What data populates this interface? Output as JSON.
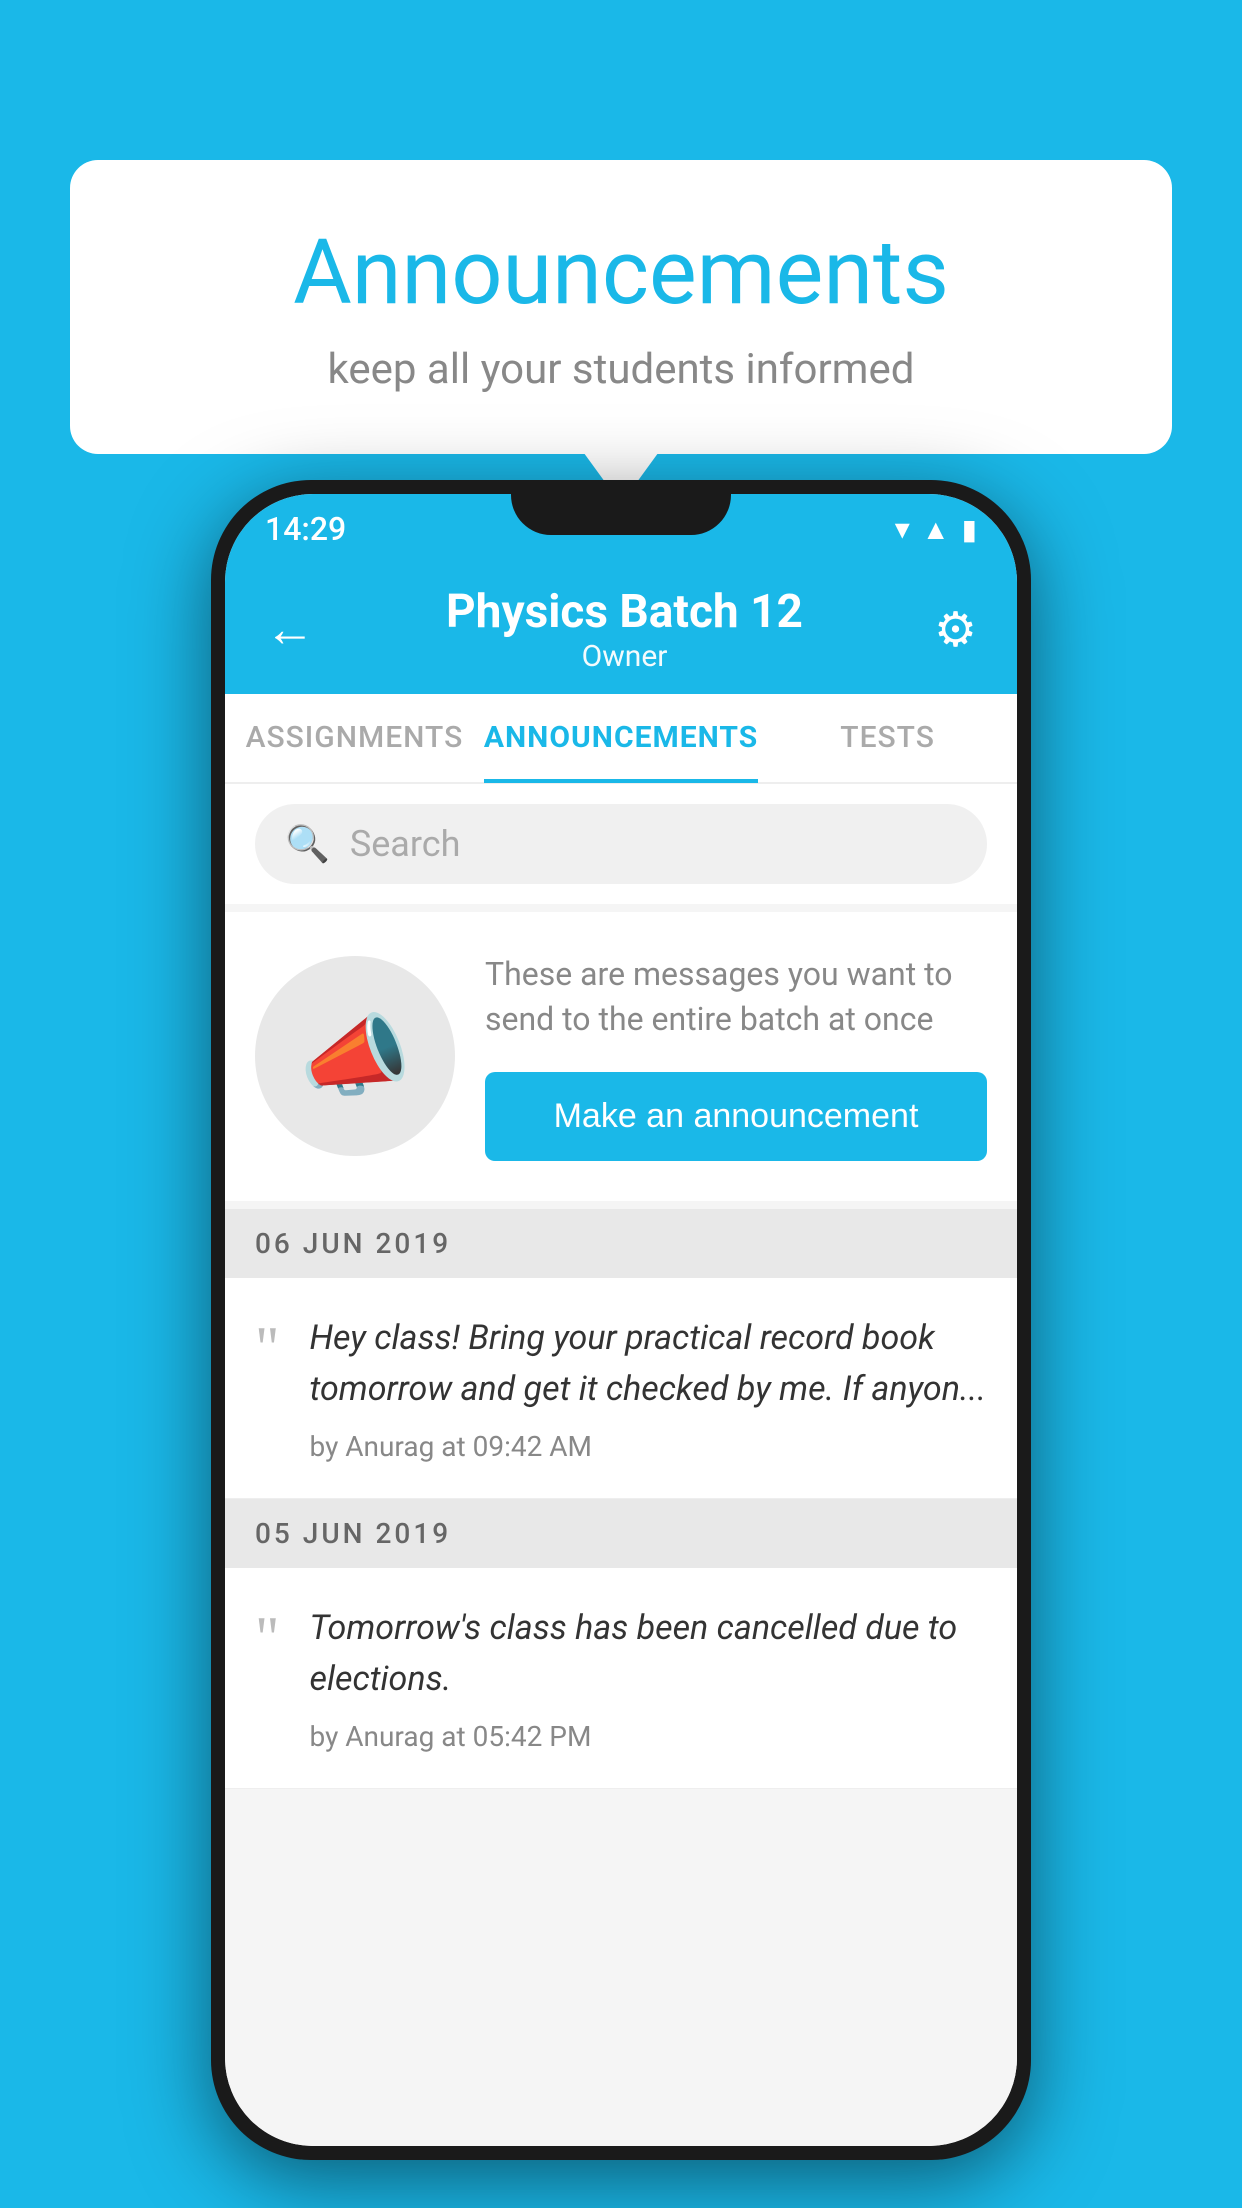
{
  "background_color": "#1ab8e8",
  "speech_bubble": {
    "title": "Announcements",
    "subtitle": "keep all your students informed"
  },
  "phone": {
    "status_bar": {
      "time": "14:29"
    },
    "header": {
      "title": "Physics Batch 12",
      "subtitle": "Owner",
      "back_label": "←",
      "gear_label": "⚙"
    },
    "tabs": [
      {
        "label": "ASSIGNMENTS",
        "active": false
      },
      {
        "label": "ANNOUNCEMENTS",
        "active": true
      },
      {
        "label": "TESTS",
        "active": false
      }
    ],
    "search": {
      "placeholder": "Search"
    },
    "promo": {
      "description": "These are messages you want to send to the entire batch at once",
      "button_label": "Make an announcement"
    },
    "announcements": [
      {
        "date": "06  JUN  2019",
        "text": "Hey class! Bring your practical record book tomorrow and get it checked by me. If anyon...",
        "meta": "by Anurag at 09:42 AM"
      },
      {
        "date": "05  JUN  2019",
        "text": "Tomorrow's class has been cancelled due to elections.",
        "meta": "by Anurag at 05:42 PM"
      }
    ]
  }
}
